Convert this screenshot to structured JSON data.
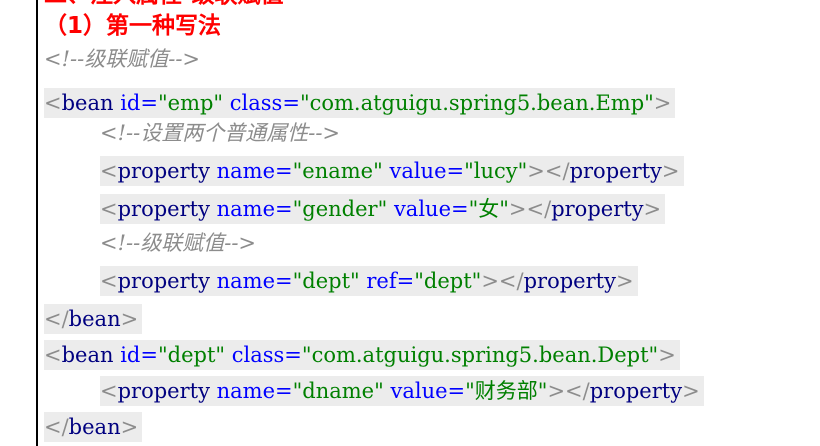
{
  "heading_partial": "二、注入属性-级联赋值",
  "heading": "（1）第一种写法",
  "comment_cascade": "<!--级联赋值-->",
  "comment_two_props": "<!--设置两个普通属性-->",
  "tag_bean": "bean",
  "tag_property": "property",
  "attr_id": "id=",
  "attr_class": "class=",
  "attr_name": "name=",
  "attr_value": "value=",
  "attr_ref": "ref=",
  "emp_id_value": "\"emp\"",
  "emp_class_value": "\"com.atguigu.spring5.bean.Emp\"",
  "ename_name_value": "\"ename\"",
  "ename_value_value": "\"lucy\"",
  "gender_name_value": "\"gender\"",
  "gender_value_value": "\"女\"",
  "dept_name_value": "\"dept\"",
  "dept_ref_value": "\"dept\"",
  "dept_id_value": "\"dept\"",
  "dept_class_value": "\"com.atguigu.spring5.bean.Dept\"",
  "dname_name_value": "\"dname\"",
  "dname_value_value": "\"财务部\"",
  "lt": "<",
  "gt": ">",
  "lt_slash": "</",
  "gt_lt_slash": "></",
  "colors": {
    "heading": "#ff0000",
    "comment": "#8c8c8c",
    "tag": "#000080",
    "attribute": "#0000ff",
    "value": "#008000",
    "code_background": "#ececec"
  }
}
